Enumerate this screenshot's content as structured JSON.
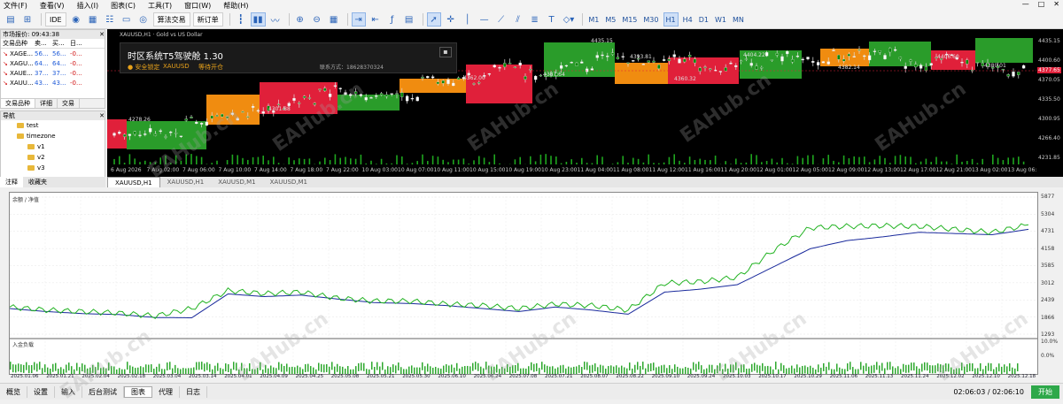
{
  "menu": [
    "文件(F)",
    "查看(V)",
    "插入(I)",
    "图表(C)",
    "工具(T)",
    "窗口(W)",
    "帮助(H)"
  ],
  "window_controls": [
    "—",
    "□",
    "✕"
  ],
  "toolbar": {
    "ide_label": "IDE",
    "algo_label": "算法交易",
    "new_order_label": "新订单",
    "timeframes": [
      "M1",
      "M5",
      "M15",
      "M30",
      "H1",
      "H4",
      "D1",
      "W1",
      "MN"
    ],
    "active_timeframe": "H1"
  },
  "market_watch": {
    "title": "市场报价: 09:43:38",
    "headers": [
      "交易品种",
      "卖...",
      "买...",
      "日..."
    ],
    "rows": [
      {
        "symbol": "XAGE...",
        "bid": "56...",
        "ask": "56...",
        "chg": "-0..."
      },
      {
        "symbol": "XAGU...",
        "bid": "64...",
        "ask": "64...",
        "chg": "-0..."
      },
      {
        "symbol": "XAUE...",
        "bid": "37...",
        "ask": "37...",
        "chg": "-0..."
      },
      {
        "symbol": "XAUU...",
        "bid": "43...",
        "ask": "43...",
        "chg": "-0..."
      }
    ],
    "tabs": [
      "交易品种",
      "详细",
      "交易"
    ]
  },
  "navigator": {
    "title": "导航",
    "items": [
      "test",
      "timezone",
      "v1",
      "v2",
      "v3"
    ],
    "tabs": [
      "注释",
      "收藏夹"
    ]
  },
  "chart_main": {
    "title": "XAUUSD,H1 · Gold vs US Dollar",
    "panel_title": "时区系统T5驾驶舱 1.30",
    "panel_status1": "● 安全锁定",
    "panel_status2": "XAUUSD",
    "panel_status3": "等待开仓",
    "panel_contact": "联系方式：18628370324",
    "price_scale": [
      "4435.15",
      "4400.60",
      "4370.05",
      "4335.50",
      "4300.95",
      "4266.40",
      "4231.85"
    ],
    "current_price": "4377.65",
    "times": [
      "6 Aug 2026",
      "7 Aug 02:00",
      "7 Aug 06:00",
      "7 Aug 10:00",
      "7 Aug 14:00",
      "7 Aug 18:00",
      "7 Aug 22:00",
      "10 Aug 03:00",
      "10 Aug 07:00",
      "10 Aug 11:00",
      "10 Aug 15:00",
      "10 Aug 19:00",
      "10 Aug 23:00",
      "11 Aug 04:00",
      "11 Aug 08:00",
      "11 Aug 12:00",
      "11 Aug 16:00",
      "11 Aug 20:00",
      "12 Aug 01:00",
      "12 Aug 05:00",
      "12 Aug 09:00",
      "12 Aug 13:00",
      "12 Aug 17:00",
      "12 Aug 21:00",
      "13 Aug 02:00",
      "13 Aug 06:00"
    ],
    "box_labels": [
      "4278.26",
      "4301.88",
      "4362.00",
      "4387.64",
      "4435.15",
      "4393.81",
      "4360.32",
      "4404.22",
      "4382.14",
      "4406.60",
      "4380.01"
    ]
  },
  "chart_tabs": [
    "XAUUSD,H1",
    "XAUUSD,H1",
    "XAUUSD,M1",
    "XAUUSD,M1"
  ],
  "backtest": {
    "legend": "余额 / 净值",
    "volume_label": "入金负载",
    "y_scale": [
      "5877",
      "5304",
      "4731",
      "4158",
      "3585",
      "3012",
      "2439",
      "1866",
      "1293"
    ],
    "pct_scale": [
      "10.0%",
      "0.0%"
    ],
    "dates": [
      "2025.01.06",
      "2025.01.21",
      "2025.02.04",
      "2025.02.18",
      "2025.03.04",
      "2025.03.14",
      "2025.04.01",
      "2025.04.09",
      "2025.04.25",
      "2025.05.08",
      "2025.05.21",
      "2025.05.30",
      "2025.06.10",
      "2025.06.24",
      "2025.07.08",
      "2025.07.21",
      "2025.08.07",
      "2025.08.22",
      "2025.09.10",
      "2025.09.24",
      "2025.10.03",
      "2025.10.17",
      "2025.10.29",
      "2025.11.06",
      "2025.11.13",
      "2025.11.24",
      "2025.12.02",
      "2025.12.10",
      "2025.12.18"
    ]
  },
  "watermark": "EAHub.cn",
  "status_bar": {
    "tabs": [
      "概览",
      "设置",
      "输入",
      "后台测试",
      "图表",
      "代理",
      "日志"
    ],
    "active": "图表",
    "time": "02:06:03 / 02:06:10",
    "start": "开始"
  },
  "chart_data": {
    "type": "line",
    "title": "",
    "xlabel": "",
    "ylabel": "",
    "ylim": [
      1293,
      5877
    ],
    "series": [
      {
        "name": "余额",
        "color": "#1a2a9c",
        "values": [
          2150,
          2050,
          1980,
          1950,
          1850,
          1840,
          2640,
          2550,
          2600,
          2470,
          2350,
          2320,
          2250,
          2150,
          2050,
          2200,
          2100,
          1960,
          2700,
          2800,
          2950,
          3550,
          4150,
          4420,
          4550,
          4700,
          4660,
          4620,
          4800
        ]
      },
      {
        "name": "净值",
        "color": "#22b322",
        "values": [
          2200,
          2100,
          2050,
          2000,
          1900,
          2150,
          2750,
          2650,
          2700,
          2500,
          2400,
          2400,
          2300,
          2250,
          2150,
          2300,
          2250,
          2100,
          3000,
          3050,
          3200,
          4100,
          4850,
          4900,
          4920,
          4900,
          4800,
          4700,
          4950
        ]
      }
    ]
  }
}
